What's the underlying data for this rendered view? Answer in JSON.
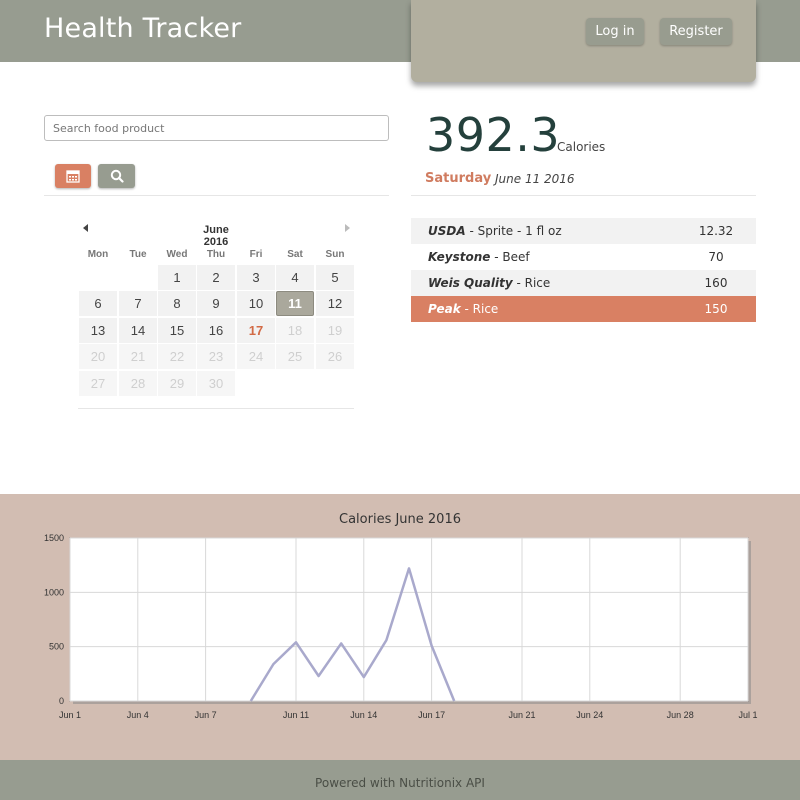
{
  "header": {
    "title": "Health Tracker",
    "login_label": "Log in",
    "register_label": "Register"
  },
  "search": {
    "placeholder": "Search food product",
    "value": ""
  },
  "buttons": {
    "calendar_icon": "calendar-icon",
    "search_icon": "search-icon"
  },
  "calendar": {
    "month_label": "June 2016",
    "weekdays": [
      "Mon",
      "Tue",
      "Wed",
      "Thu",
      "Fri",
      "Sat",
      "Sun"
    ],
    "days": [
      "1",
      "2",
      "3",
      "4",
      "5",
      "6",
      "7",
      "8",
      "9",
      "10",
      "11",
      "12",
      "13",
      "14",
      "15",
      "16",
      "17",
      "18",
      "19",
      "20",
      "21",
      "22",
      "23",
      "24",
      "25",
      "26",
      "27",
      "28",
      "29",
      "30"
    ],
    "selected_day": "11",
    "today_day": "17"
  },
  "summary": {
    "calories": "392.3",
    "unit": "Calories",
    "weekday": "Saturday",
    "date": "June 11 2016"
  },
  "foods": [
    {
      "brand": "USDA",
      "name": " - Sprite - 1 fl oz",
      "value": "12.32"
    },
    {
      "brand": "Keystone",
      "name": " - Beef",
      "value": "70"
    },
    {
      "brand": "Weis Quality",
      "name": " - Rice",
      "value": "160"
    },
    {
      "brand": "Peak",
      "name": " - Rice",
      "value": "150"
    }
  ],
  "chart_data": {
    "type": "line",
    "title": "Calories June 2016",
    "x": [
      "2016-06-01",
      "2016-06-02",
      "2016-06-03",
      "2016-06-04",
      "2016-06-05",
      "2016-06-06",
      "2016-06-07",
      "2016-06-08",
      "2016-06-09",
      "2016-06-10",
      "2016-06-11",
      "2016-06-12",
      "2016-06-13",
      "2016-06-14",
      "2016-06-15",
      "2016-06-16",
      "2016-06-17",
      "2016-06-18",
      "2016-06-19",
      "2016-06-20",
      "2016-06-21",
      "2016-06-22",
      "2016-06-23",
      "2016-06-24",
      "2016-06-25",
      "2016-06-26",
      "2016-06-27",
      "2016-06-28",
      "2016-06-29",
      "2016-06-30",
      "2016-07-01"
    ],
    "series": [
      {
        "values": [
          0,
          0,
          0,
          0,
          0,
          0,
          0,
          0,
          0,
          340,
          540,
          230,
          530,
          220,
          560,
          1220,
          510,
          0,
          0,
          0,
          0,
          0,
          0,
          0,
          0,
          0,
          0,
          0,
          0,
          0,
          0
        ]
      }
    ],
    "x_tick_labels": [
      "Jun 1",
      "Jun 4",
      "Jun 7",
      "Jun 11",
      "Jun 14",
      "Jun 17",
      "Jun 21",
      "Jun 24",
      "Jun 28",
      "Jul 1"
    ],
    "y_ticks": [
      "0",
      "500",
      "1000",
      "1500"
    ],
    "ylim": [
      0,
      1500
    ],
    "grid": true,
    "line_color": "#a9a9cc"
  },
  "footer": {
    "text": "Powered with Nutritionix API"
  },
  "colors": {
    "header": "#979c90",
    "accent": "#d98063",
    "chart_bg": "#d2bdb2",
    "big_number": "#24403c"
  }
}
